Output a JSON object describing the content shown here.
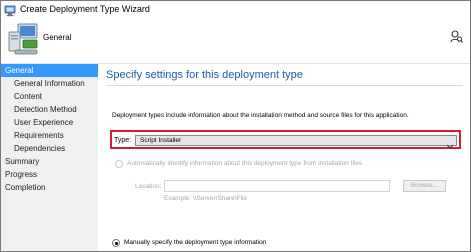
{
  "window": {
    "title": "Create Deployment Type Wizard"
  },
  "header": {
    "page_name": "General"
  },
  "sidebar": {
    "items": [
      {
        "label": "General",
        "selected": true,
        "level": 0
      },
      {
        "label": "General Information",
        "selected": false,
        "level": 1
      },
      {
        "label": "Content",
        "selected": false,
        "level": 1
      },
      {
        "label": "Detection Method",
        "selected": false,
        "level": 1
      },
      {
        "label": "User Experience",
        "selected": false,
        "level": 1
      },
      {
        "label": "Requirements",
        "selected": false,
        "level": 1
      },
      {
        "label": "Dependencies",
        "selected": false,
        "level": 1
      },
      {
        "label": "Summary",
        "selected": false,
        "level": 0
      },
      {
        "label": "Progress",
        "selected": false,
        "level": 0
      },
      {
        "label": "Completion",
        "selected": false,
        "level": 0
      }
    ]
  },
  "content": {
    "title": "Specify settings for this deployment type",
    "description": "Deployment types include information about the installation method and source files for this application.",
    "type_label": "Type:",
    "type_value": "Script Installer",
    "auto_label": "Automatically identify information about this deployment type from installation files",
    "location_label": "Location:",
    "location_value": "",
    "browse_label": "Browse...",
    "example_text": "Example:  \\\\Server\\Share\\File",
    "manual_label": "Manually specify the deployment type information"
  },
  "colors": {
    "accent_blue": "#3399ff",
    "title_blue": "#1e5fa8",
    "highlight_red": "#d11f2f"
  },
  "icons": [
    "wizard-app-icon",
    "computer-icon",
    "user-search-icon",
    "chevron-down-icon"
  ]
}
